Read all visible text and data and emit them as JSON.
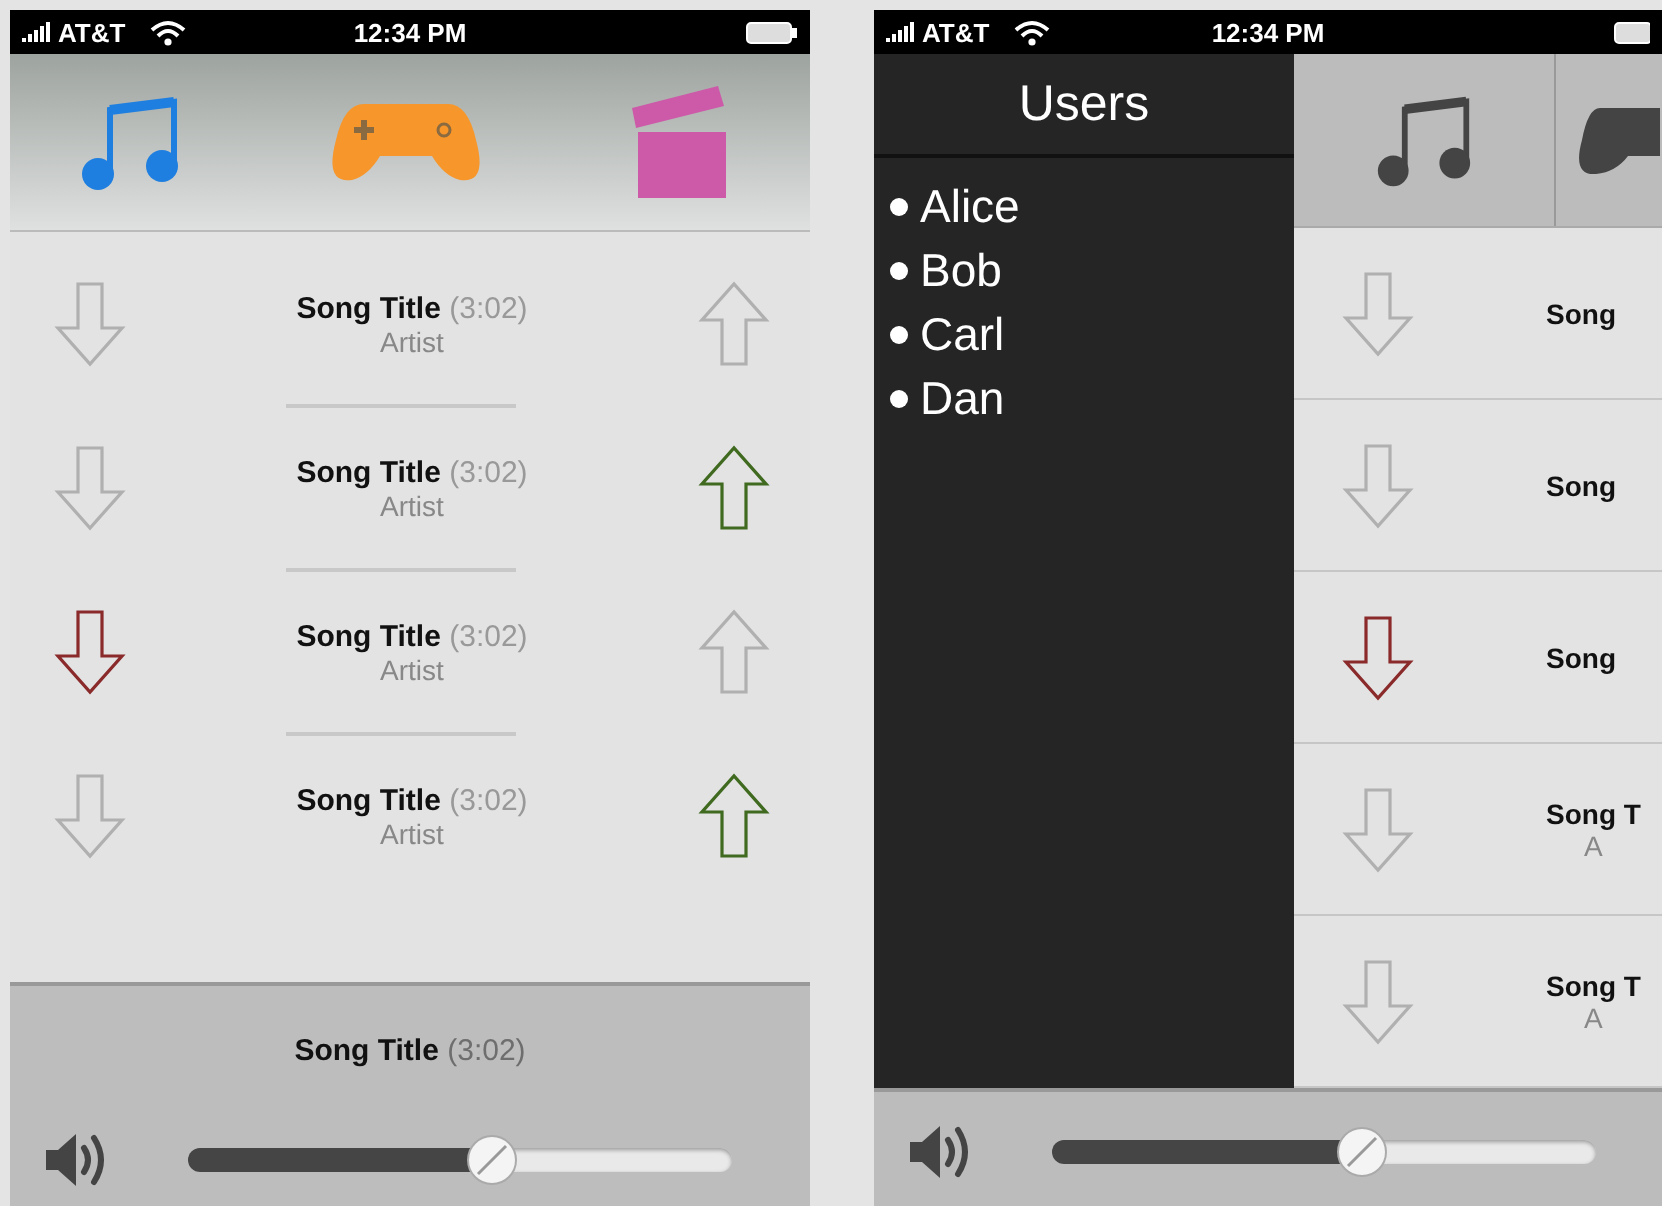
{
  "left_screen": {
    "status_bar": {
      "carrier": "AT&T",
      "time": "12:34 PM"
    },
    "songs": [
      {
        "title": "Song Title",
        "duration": "(3:02)",
        "artist": "Artist",
        "liked": false,
        "disliked": false
      },
      {
        "title": "Song Title",
        "duration": "(3:02)",
        "artist": "Artist",
        "liked": true,
        "disliked": false
      },
      {
        "title": "Song Title",
        "duration": "(3:02)",
        "artist": "Artist",
        "liked": false,
        "disliked": true
      },
      {
        "title": "Song Title",
        "duration": "(3:02)",
        "artist": "Artist",
        "liked": true,
        "disliked": false
      }
    ],
    "now_playing": {
      "title": "Song Title",
      "duration": "(3:02)"
    },
    "volume": {
      "level": 0.56
    }
  },
  "right_screen": {
    "status_bar": {
      "carrier": "AT&T",
      "time": "12:34 PM"
    },
    "sidebar": {
      "title": "Users",
      "items": [
        "Alice",
        "Bob",
        "Carl",
        "Dan"
      ]
    },
    "songs": [
      {
        "title": "Song",
        "disliked": false
      },
      {
        "title": "Song",
        "disliked": false
      },
      {
        "title": "Song",
        "disliked": true
      },
      {
        "title": "Song T",
        "artist": "A",
        "disliked": false
      },
      {
        "title": "Song T",
        "artist": "A",
        "disliked": false
      }
    ],
    "volume": {
      "level": 0.57
    }
  }
}
